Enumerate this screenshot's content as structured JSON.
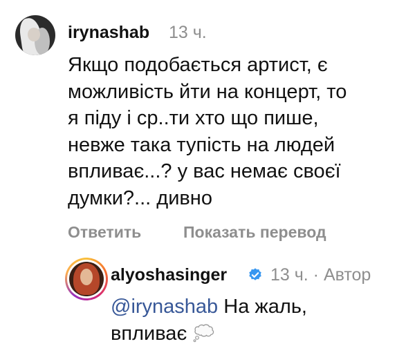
{
  "comment": {
    "username": "irynashab",
    "time": "13 ч.",
    "lines": [
      "Якщо подобається артист, є",
      "можливість йти на концерт, то",
      "я піду і ср..ти хто що пише,",
      "невже така тупість на людей",
      "впливає...? у вас немає своєї",
      "думки?... дивно"
    ],
    "actions": {
      "reply": "Ответить",
      "translate": "Показать перевод"
    }
  },
  "reply": {
    "username": "alyoshasinger",
    "meta": "13 ч. · Автор",
    "mention": "@irynashab",
    "line1_rest": " На жаль,",
    "line2": "впливає",
    "emoji": "thought-bubble-icon"
  }
}
